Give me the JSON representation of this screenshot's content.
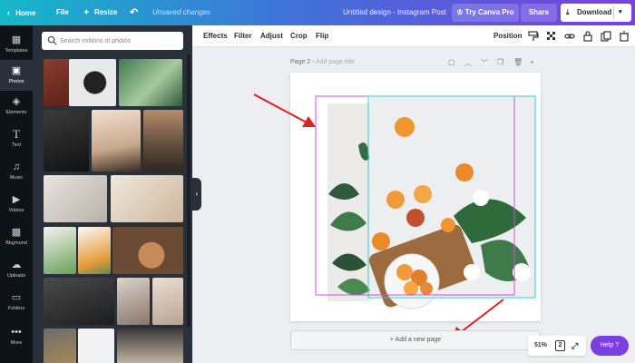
{
  "topbar": {
    "home": "Home",
    "file": "File",
    "resize": "Resize",
    "unsaved": "Unsaved changes",
    "title": "Untitled design - Instagram Post",
    "try_pro": "Try Canva Pro",
    "share": "Share",
    "download": "Download"
  },
  "rail": {
    "items": [
      {
        "label": "Templates",
        "icon": "templates-icon"
      },
      {
        "label": "Photos",
        "icon": "photos-icon"
      },
      {
        "label": "Elements",
        "icon": "elements-icon"
      },
      {
        "label": "Text",
        "icon": "text-icon"
      },
      {
        "label": "Music",
        "icon": "music-icon"
      },
      {
        "label": "Videos",
        "icon": "videos-icon"
      },
      {
        "label": "Bkground",
        "icon": "background-icon"
      },
      {
        "label": "Uploads",
        "icon": "uploads-icon"
      },
      {
        "label": "Folders",
        "icon": "folders-icon"
      },
      {
        "label": "More",
        "icon": "more-icon"
      }
    ],
    "active_index": 1
  },
  "panel": {
    "search_placeholder": "Search millions of photos"
  },
  "toolbar": {
    "effects": "Effects",
    "filter": "Filter",
    "adjust": "Adjust",
    "crop": "Crop",
    "flip": "Flip",
    "position": "Position"
  },
  "page": {
    "label": "Page 2",
    "title_placeholder": "Add page title"
  },
  "footer": {
    "add_page": "+ Add a new page",
    "zoom": "51%",
    "page_count": "2",
    "help": "Help ?"
  },
  "colors": {
    "gradient_start": "#14b8c8",
    "gradient_end": "#7b3fe0",
    "rail_bg": "#0e1318",
    "panel_bg": "#293039",
    "arrow": "#e02020",
    "guide_magenta": "#d14fd6",
    "guide_cyan": "#2fd0d0"
  }
}
